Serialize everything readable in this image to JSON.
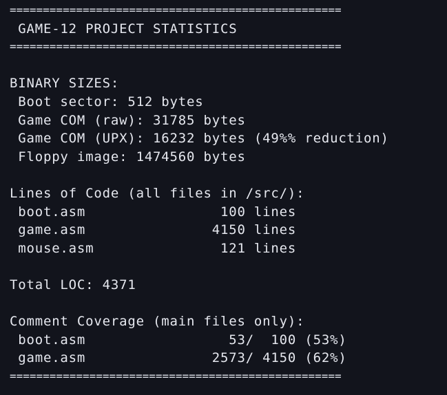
{
  "terminal": {
    "lines": [
      "==================================================",
      " GAME-12 PROJECT STATISTICS",
      "==================================================",
      "",
      "BINARY SIZES:",
      " Boot sector: 512 bytes",
      " Game COM (raw): 31785 bytes",
      " Game COM (UPX): 16232 bytes (49%% reduction)",
      " Floppy image: 1474560 bytes",
      "",
      "Lines of Code (all files in /src/):",
      " boot.asm                100 lines",
      " game.asm               4150 lines",
      " mouse.asm               121 lines",
      "",
      "Total LOC: 4371",
      "",
      "Comment Coverage (main files only):",
      " boot.asm                 53/  100 (53%)",
      " game.asm               2573/ 4150 (62%)",
      "=================================================="
    ]
  }
}
